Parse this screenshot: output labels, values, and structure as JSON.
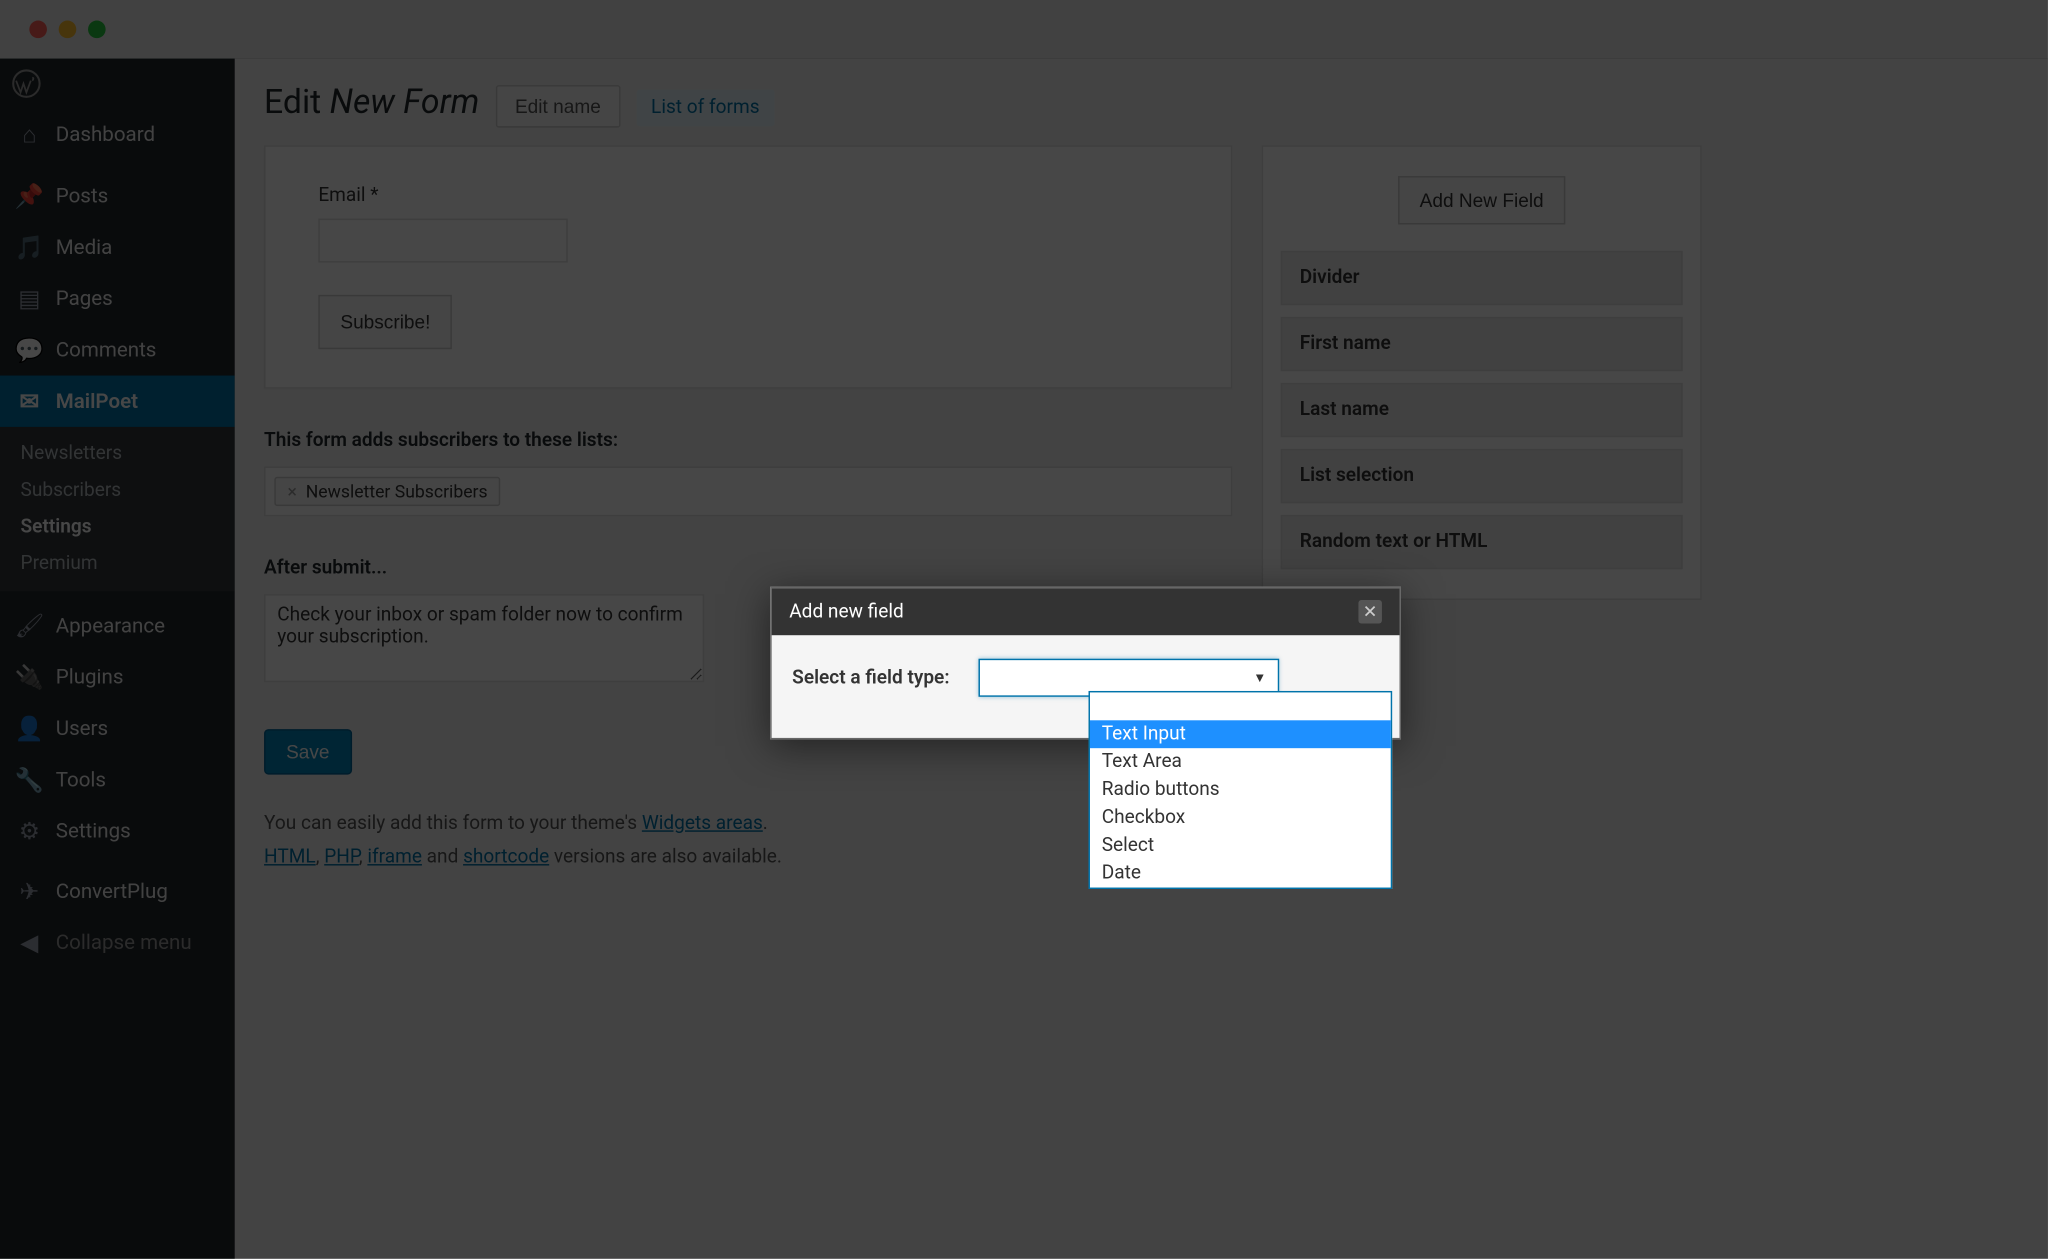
{
  "sidebar": {
    "items": [
      {
        "icon": "dashboard",
        "label": "Dashboard"
      },
      {
        "icon": "pin",
        "label": "Posts"
      },
      {
        "icon": "media",
        "label": "Media"
      },
      {
        "icon": "pages",
        "label": "Pages"
      },
      {
        "icon": "comments",
        "label": "Comments"
      },
      {
        "icon": "mail",
        "label": "MailPoet"
      },
      {
        "icon": "appearance",
        "label": "Appearance"
      },
      {
        "icon": "plugins",
        "label": "Plugins"
      },
      {
        "icon": "users",
        "label": "Users"
      },
      {
        "icon": "tools",
        "label": "Tools"
      },
      {
        "icon": "settings",
        "label": "Settings"
      },
      {
        "icon": "convert",
        "label": "ConvertPlug"
      },
      {
        "icon": "collapse",
        "label": "Collapse menu"
      }
    ],
    "sub_items": [
      "Newsletters",
      "Subscribers",
      "Settings",
      "Premium"
    ],
    "sub_active": "Settings"
  },
  "header": {
    "title_prefix": "Edit",
    "title_italic": "New Form",
    "edit_name_btn": "Edit name",
    "list_of_forms": "List of forms"
  },
  "form_preview": {
    "email_label": "Email *",
    "subscribe_btn": "Subscribe!"
  },
  "lists_section": {
    "label": "This form adds subscribers to these lists:",
    "tag": "Newsletter Subscribers"
  },
  "after_submit": {
    "label": "After submit...",
    "text": "Check your inbox or spam folder now to confirm your subscription."
  },
  "save_btn": "Save",
  "help": {
    "line1_prefix": "You can easily add this form to your theme's ",
    "widgets_link": "Widgets areas",
    "line2_links": {
      "html": "HTML",
      "php": "PHP",
      "iframe": "iframe",
      "shortcode": "shortcode"
    },
    "line2_mid": " and ",
    "line2_suffix": " versions are also available."
  },
  "right_panel": {
    "add_new_field": "Add New Field",
    "items": [
      "Divider",
      "First name",
      "Last name",
      "List selection",
      "Random text or HTML"
    ]
  },
  "modal": {
    "title": "Add new field",
    "label": "Select a field type:",
    "options": [
      "",
      "Text Input",
      "Text Area",
      "Radio buttons",
      "Checkbox",
      "Select",
      "Date"
    ],
    "highlighted": "Text Input"
  }
}
